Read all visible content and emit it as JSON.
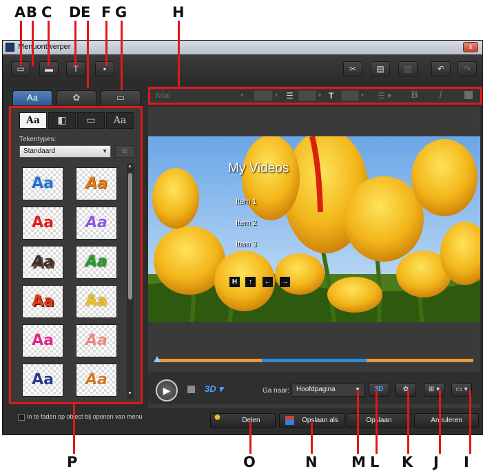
{
  "window": {
    "title": "Menuontwerper",
    "close_label": "x"
  },
  "callouts": [
    "A",
    "B",
    "C",
    "D",
    "E",
    "F",
    "G",
    "H",
    "I",
    "J",
    "K",
    "L",
    "M",
    "N",
    "O",
    "P"
  ],
  "toolbar": {
    "cut_glyph": "✂",
    "copy_glyph": "▤",
    "paste_glyph": "▤",
    "undo_glyph": "↶",
    "redo_glyph": "↷",
    "set_bg_glyph": "▭",
    "add_bg_video_glyph": "▬",
    "add_text_glyph": "T",
    "add_button_glyph": "▪"
  },
  "tabs": [
    "Aa",
    "✿",
    "▭"
  ],
  "fontbar": {
    "font": "Arial",
    "size": "",
    "line_spacing": "",
    "char_spacing": "",
    "bold": "B",
    "italic": "I"
  },
  "left_panel": {
    "subtabs": [
      "Aa",
      "◧",
      "▭",
      "Aa"
    ],
    "font_types_label": "Tekentypes:",
    "font_type_value": "Standaard",
    "presets": [
      "Aa",
      "Aa",
      "Aa",
      "Aa",
      "Aa",
      "Aa",
      "Aa",
      "Aa",
      "Aa",
      "Aa",
      "Aa",
      "Aa"
    ],
    "preset_colors": [
      "#2a6fc4",
      "#e07a1c",
      "#e01d1d",
      "#8a5be0",
      "#333333",
      "#22a025",
      "#d8401c",
      "#e8c21c",
      "#e0248a",
      "#e88a80",
      "#2c3a8a",
      "#d2782a"
    ]
  },
  "preview": {
    "menu_title": "My Videos",
    "items": [
      "Item 1",
      "Item 2",
      "Item 3"
    ],
    "nav_buttons": [
      "H",
      "↑",
      "←",
      "→"
    ],
    "timeline_position": 0.0
  },
  "controls": {
    "play_glyph": "▶",
    "threed_label": "3D ▾",
    "goto_label": "Ga naar:",
    "goto_value": "Hoofdpagina",
    "l_btn": "3D",
    "k_btn": "✿",
    "j_btn": "⊞ ▾",
    "i_btn": "▭ ▾"
  },
  "bottom": {
    "fade_label": "In te faden op object bij openen van menu",
    "share": "Delen",
    "save_as": "Opslaan als",
    "save": "Opslaan",
    "cancel": "Annuleren"
  }
}
